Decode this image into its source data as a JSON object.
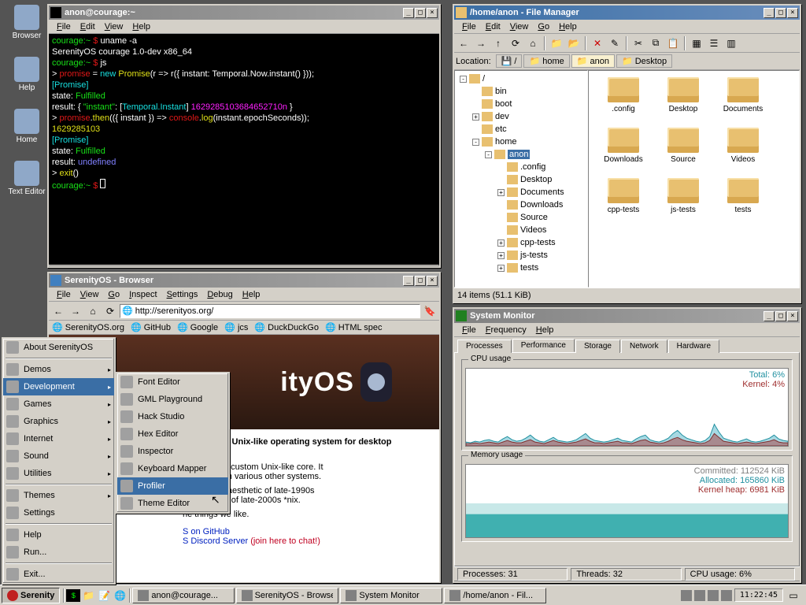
{
  "desktop_icons": [
    {
      "label": "Browser"
    },
    {
      "label": "Help"
    },
    {
      "label": "Home"
    },
    {
      "label": "Text Editor"
    }
  ],
  "terminal": {
    "title": "anon@courage:~",
    "menu": [
      "File",
      "Edit",
      "View",
      "Help"
    ],
    "lines": [
      [
        [
          "green",
          "courage:~ "
        ],
        [
          "red",
          "$ "
        ],
        [
          "white",
          "uname -a"
        ]
      ],
      [
        [
          "white",
          "SerenityOS courage 1.0-dev x86_64"
        ]
      ],
      [
        [
          "green",
          "courage:~ "
        ],
        [
          "red",
          "$ "
        ],
        [
          "white",
          "js"
        ]
      ],
      [
        [
          "white",
          "> "
        ],
        [
          "red",
          "promise "
        ],
        [
          "white",
          "= "
        ],
        [
          "cyan",
          "new "
        ],
        [
          "yellow",
          "Promise"
        ],
        [
          "white",
          "(r => r({ instant: Temporal.Now.instant() }));"
        ]
      ],
      [
        [
          "cyan",
          "[Promise]"
        ]
      ],
      [
        [
          "white",
          "  state: "
        ],
        [
          "green",
          "Fulfilled"
        ]
      ],
      [
        [
          "white",
          "  result: { "
        ],
        [
          "green",
          "\"instant\""
        ],
        [
          "white",
          ": ["
        ],
        [
          "cyan",
          "Temporal.Instant"
        ],
        [
          "white",
          "] "
        ],
        [
          "magenta",
          "1629285103684652710n"
        ],
        [
          "white",
          " }"
        ]
      ],
      [
        [
          "white",
          "> "
        ],
        [
          "red",
          "promise"
        ],
        [
          "white",
          "."
        ],
        [
          "yellow",
          "then"
        ],
        [
          "white",
          "(({ instant }) => "
        ],
        [
          "red",
          "console"
        ],
        [
          "white",
          "."
        ],
        [
          "yellow",
          "log"
        ],
        [
          "white",
          "(instant.epochSeconds));"
        ]
      ],
      [
        [
          "yellow",
          "1629285103"
        ]
      ],
      [
        [
          "cyan",
          "[Promise]"
        ]
      ],
      [
        [
          "white",
          "  state: "
        ],
        [
          "green",
          "Fulfilled"
        ]
      ],
      [
        [
          "white",
          "  result: "
        ],
        [
          "blue",
          "undefined"
        ]
      ],
      [
        [
          "white",
          "> "
        ],
        [
          "yellow",
          "exit"
        ],
        [
          "white",
          "()"
        ]
      ],
      [
        [
          "green",
          "courage:~ "
        ],
        [
          "red",
          "$ "
        ]
      ]
    ]
  },
  "filemanager": {
    "title": "/home/anon - File Manager",
    "menu": [
      "File",
      "Edit",
      "View",
      "Go",
      "Help"
    ],
    "location_label": "Location:",
    "breadcrumb": [
      "/",
      "home",
      "anon",
      "Desktop"
    ],
    "tree": [
      {
        "d": 0,
        "exp": "-",
        "label": "/"
      },
      {
        "d": 1,
        "exp": "",
        "label": "bin"
      },
      {
        "d": 1,
        "exp": "",
        "label": "boot"
      },
      {
        "d": 1,
        "exp": "+",
        "label": "dev"
      },
      {
        "d": 1,
        "exp": "",
        "label": "etc"
      },
      {
        "d": 1,
        "exp": "-",
        "label": "home"
      },
      {
        "d": 2,
        "exp": "-",
        "label": "anon",
        "sel": true
      },
      {
        "d": 3,
        "exp": "",
        "label": ".config"
      },
      {
        "d": 3,
        "exp": "",
        "label": "Desktop"
      },
      {
        "d": 3,
        "exp": "+",
        "label": "Documents"
      },
      {
        "d": 3,
        "exp": "",
        "label": "Downloads"
      },
      {
        "d": 3,
        "exp": "",
        "label": "Source"
      },
      {
        "d": 3,
        "exp": "",
        "label": "Videos"
      },
      {
        "d": 3,
        "exp": "+",
        "label": "cpp-tests"
      },
      {
        "d": 3,
        "exp": "+",
        "label": "js-tests"
      },
      {
        "d": 3,
        "exp": "+",
        "label": "tests"
      }
    ],
    "folders": [
      ".config",
      "Desktop",
      "Documents",
      "Downloads",
      "Source",
      "Videos",
      "cpp-tests",
      "js-tests",
      "tests"
    ],
    "status": "14 items (51.1 KiB)"
  },
  "browser": {
    "title": "SerenityOS - Browser",
    "menu": [
      "File",
      "View",
      "Go",
      "Inspect",
      "Settings",
      "Debug",
      "Help"
    ],
    "url": "http://serenityos.org/",
    "bookmarks": [
      "SerenityOS.org",
      "GitHub",
      "Google",
      "jcs",
      "DuckDuckGo",
      "HTML spec"
    ],
    "page": {
      "heading": "A graphical Unix-like operating system for desktop computers!",
      "p1_tail": "faces with a custom Unix-like core. It",
      "p2_tail": "ul ideas from various other systems.",
      "p3a_tail": "etween the aesthetic of late-1990s",
      "p3b_tail": "accessibility of late-2000s *nix.",
      "p4_tail": "he things we like.",
      "link1": "S on GitHub",
      "link2": "S Discord Server",
      "link2_tail": " (join here to chat!)"
    }
  },
  "sysmon": {
    "title": "System Monitor",
    "menu": [
      "File",
      "Frequency",
      "Help"
    ],
    "tabs": [
      "Processes",
      "Performance",
      "Storage",
      "Network",
      "Hardware"
    ],
    "active_tab": 1,
    "cpu_title": "CPU usage",
    "cpu_total_label": "Total: 6%",
    "cpu_kernel_label": "Kernel: 4%",
    "mem_title": "Memory usage",
    "mem_committed": "Committed: 112524 KiB",
    "mem_allocated": "Allocated: 165860 KiB",
    "mem_kernel": "Kernel heap: 6981 KiB",
    "status": {
      "processes": "Processes: 31",
      "threads": "Threads: 32",
      "cpu": "CPU usage: 6%"
    }
  },
  "startmenu": {
    "items": [
      {
        "label": "About SerenityOS"
      },
      {
        "sep": true
      },
      {
        "label": "Demos",
        "arrow": true
      },
      {
        "label": "Development",
        "arrow": true,
        "hov": true
      },
      {
        "label": "Games",
        "arrow": true
      },
      {
        "label": "Graphics",
        "arrow": true
      },
      {
        "label": "Internet",
        "arrow": true
      },
      {
        "label": "Sound",
        "arrow": true
      },
      {
        "label": "Utilities",
        "arrow": true
      },
      {
        "sep": true
      },
      {
        "label": "Themes",
        "arrow": true
      },
      {
        "label": "Settings"
      },
      {
        "sep": true
      },
      {
        "label": "Help"
      },
      {
        "label": "Run..."
      },
      {
        "sep": true
      },
      {
        "label": "Exit..."
      }
    ],
    "submenu": [
      {
        "label": "Font Editor"
      },
      {
        "label": "GML Playground"
      },
      {
        "label": "Hack Studio"
      },
      {
        "label": "Hex Editor"
      },
      {
        "label": "Inspector"
      },
      {
        "label": "Keyboard Mapper"
      },
      {
        "label": "Profiler",
        "hov": true
      },
      {
        "label": "Theme Editor"
      }
    ]
  },
  "taskbar": {
    "start": "Serenity",
    "tasks": [
      {
        "label": "anon@courage..."
      },
      {
        "label": "SerenityOS - Browser"
      },
      {
        "label": "System Monitor"
      },
      {
        "label": "/home/anon - Fil..."
      }
    ],
    "clock": "11:22:45"
  },
  "chart_data": [
    {
      "type": "area",
      "title": "CPU usage",
      "ylabel": "",
      "ylim": [
        0,
        100
      ],
      "series": [
        {
          "name": "Total",
          "values": [
            5,
            4,
            6,
            5,
            7,
            8,
            6,
            5,
            9,
            12,
            8,
            6,
            7,
            10,
            14,
            9,
            6,
            5,
            8,
            11,
            7,
            6,
            5,
            6,
            8,
            12,
            16,
            10,
            7,
            6,
            5,
            6,
            8,
            10,
            7,
            6,
            5,
            9,
            12,
            14,
            8,
            6,
            5,
            7,
            10,
            16,
            20,
            14,
            10,
            8,
            6,
            5,
            7,
            12,
            28,
            18,
            10,
            8,
            6,
            5,
            7,
            9,
            6,
            5,
            6,
            8,
            10,
            14,
            9,
            7,
            6
          ]
        },
        {
          "name": "Kernel",
          "values": [
            3,
            3,
            4,
            3,
            4,
            5,
            4,
            3,
            5,
            7,
            5,
            4,
            4,
            6,
            8,
            5,
            4,
            3,
            5,
            7,
            5,
            4,
            3,
            4,
            5,
            7,
            9,
            6,
            4,
            4,
            3,
            4,
            5,
            6,
            4,
            4,
            3,
            5,
            7,
            8,
            5,
            4,
            3,
            4,
            6,
            9,
            11,
            8,
            6,
            5,
            4,
            3,
            4,
            7,
            16,
            11,
            6,
            5,
            4,
            3,
            4,
            5,
            4,
            3,
            4,
            5,
            6,
            8,
            5,
            4,
            4
          ]
        }
      ]
    },
    {
      "type": "area",
      "title": "Memory usage",
      "ylabel": "KiB",
      "series": [
        {
          "name": "Committed",
          "value_kib": 112524
        },
        {
          "name": "Allocated",
          "value_kib": 165860
        },
        {
          "name": "Kernel heap",
          "value_kib": 6981
        }
      ]
    }
  ]
}
